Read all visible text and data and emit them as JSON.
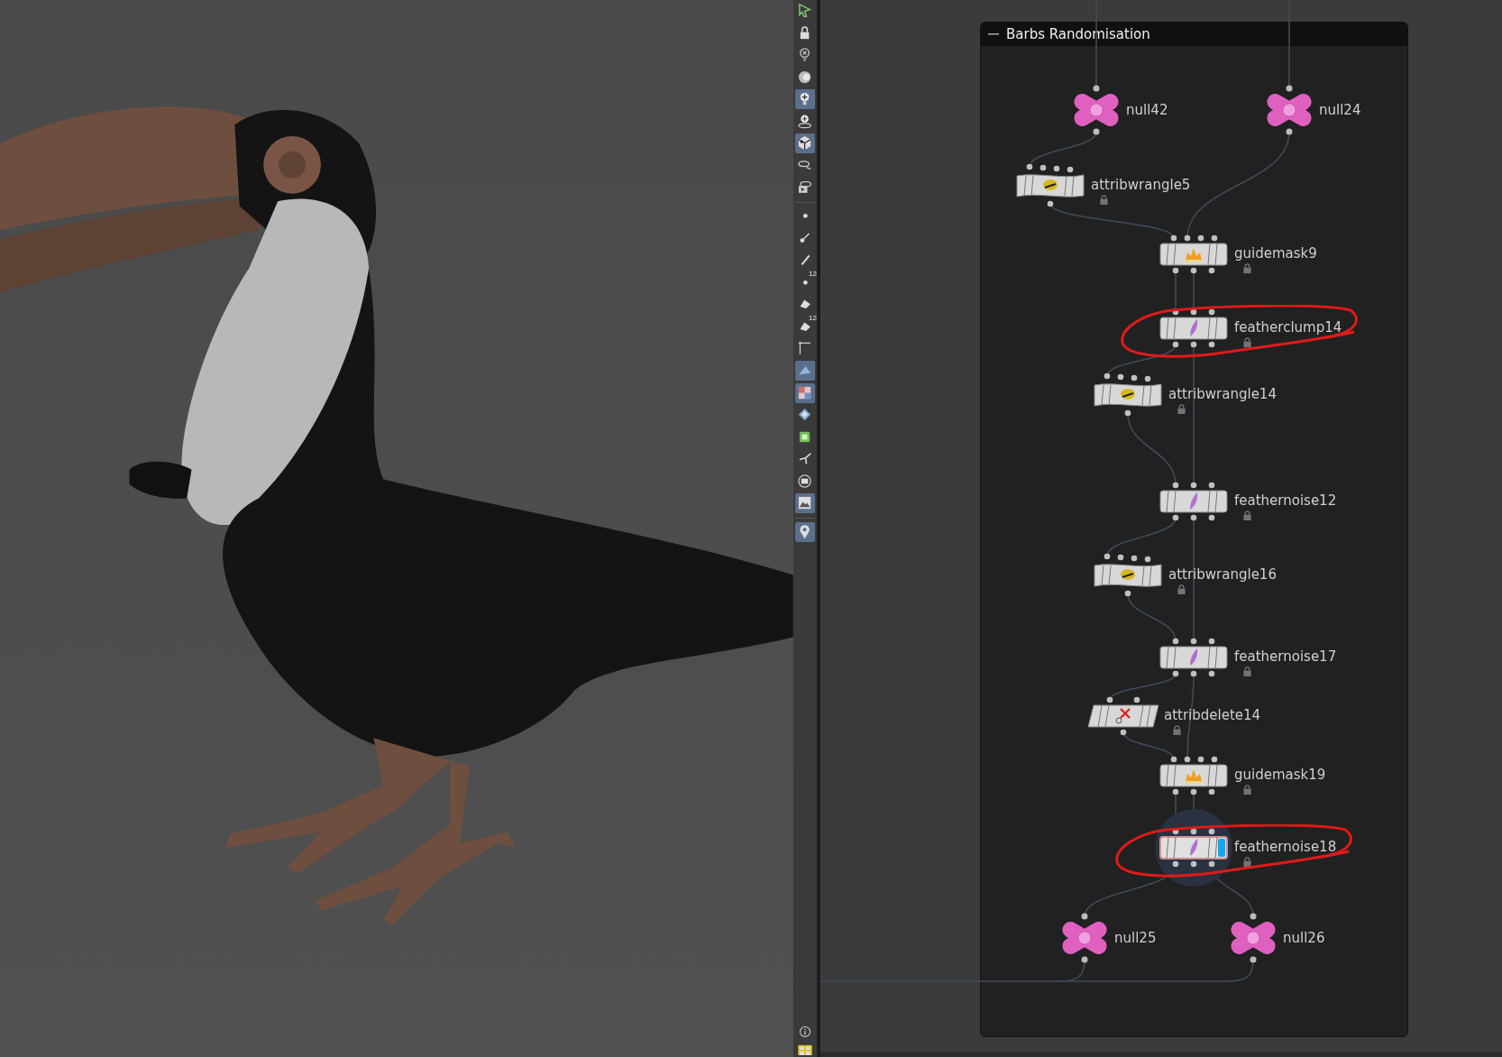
{
  "viewport_toolbar": [
    {
      "on": false
    },
    {
      "on": false
    },
    {
      "on": false
    },
    {
      "on": false
    },
    {
      "on": true
    },
    {
      "on": false
    },
    {
      "on": true
    },
    {
      "on": false
    },
    {
      "on": false
    },
    {
      "on": false
    },
    {
      "on": false
    },
    {
      "on": false
    },
    {
      "on": false,
      "badge": "12"
    },
    {
      "on": false
    },
    {
      "on": false,
      "badge": "12"
    },
    {
      "on": false
    },
    {
      "on": true
    },
    {
      "on": true
    },
    {
      "on": false
    },
    {
      "on": false
    },
    {
      "on": false
    },
    {
      "on": false
    },
    {
      "on": true
    },
    {
      "on": true
    }
  ],
  "network_box": {
    "title": "Barbs Randomisation"
  },
  "nodes": [
    {
      "name": "null42",
      "kind": "null",
      "locked": false,
      "selected": false,
      "circled": false
    },
    {
      "name": "null24",
      "kind": "null",
      "locked": false,
      "selected": false,
      "circled": false
    },
    {
      "name": "attribwrangle5",
      "kind": "wrangle",
      "locked": true,
      "selected": false,
      "circled": false
    },
    {
      "name": "guidemask9",
      "kind": "guidemask",
      "locked": true,
      "selected": false,
      "circled": false
    },
    {
      "name": "featherclump14",
      "kind": "feather",
      "locked": true,
      "selected": false,
      "circled": true
    },
    {
      "name": "attribwrangle14",
      "kind": "wrangle",
      "locked": true,
      "selected": false,
      "circled": false
    },
    {
      "name": "feathernoise12",
      "kind": "feather",
      "locked": true,
      "selected": false,
      "circled": false
    },
    {
      "name": "attribwrangle16",
      "kind": "wrangle",
      "locked": true,
      "selected": false,
      "circled": false
    },
    {
      "name": "feathernoise17",
      "kind": "feather",
      "locked": true,
      "selected": false,
      "circled": false
    },
    {
      "name": "attribdelete14",
      "kind": "attribdelete",
      "locked": true,
      "selected": false,
      "circled": false
    },
    {
      "name": "guidemask19",
      "kind": "guidemask",
      "locked": true,
      "selected": false,
      "circled": false
    },
    {
      "name": "feathernoise18",
      "kind": "feather",
      "locked": true,
      "selected": true,
      "circled": true
    },
    {
      "name": "null25",
      "kind": "null",
      "locked": false,
      "selected": false,
      "circled": false
    },
    {
      "name": "null26",
      "kind": "null",
      "locked": false,
      "selected": false,
      "circled": false
    }
  ]
}
